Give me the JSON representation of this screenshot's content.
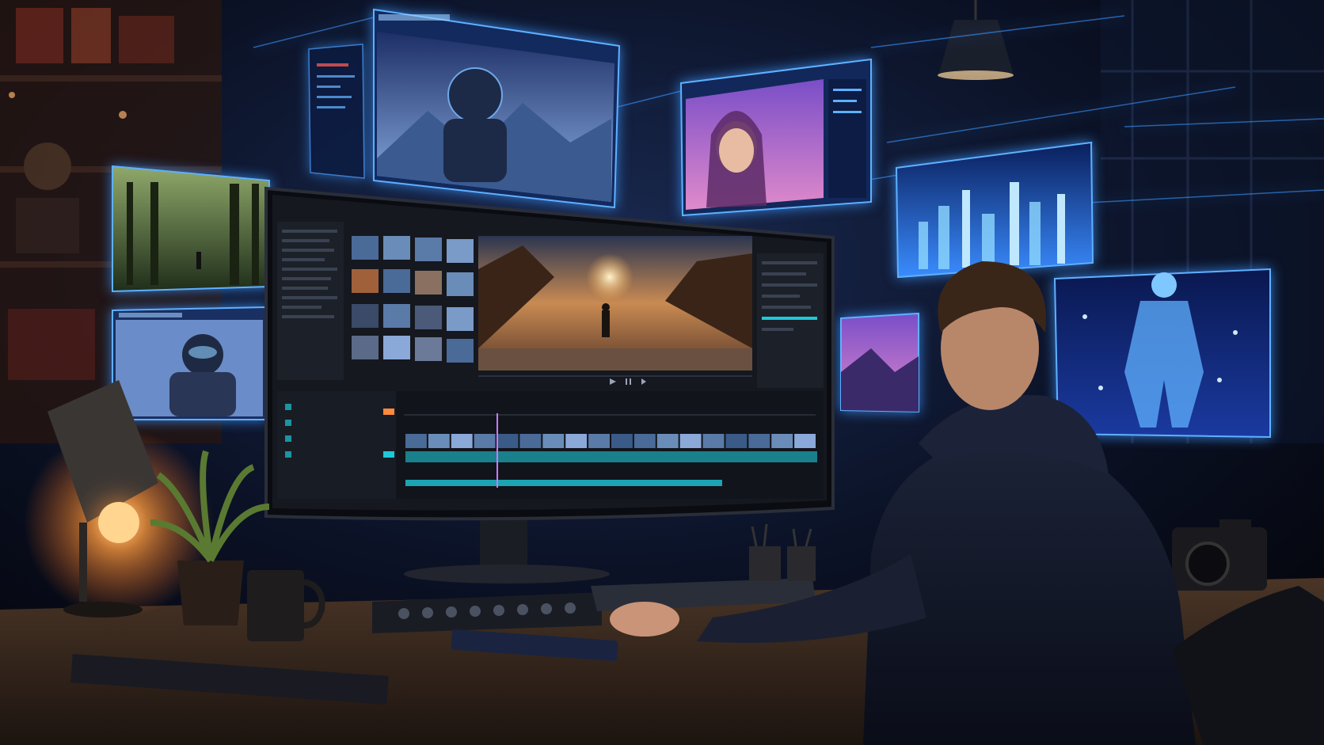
{
  "scene": {
    "holo_panels": [
      {
        "name": "holo-panel-astronaut-mountains",
        "subject": "astronaut-portrait",
        "header_text": ""
      },
      {
        "name": "holo-panel-woman-portrait",
        "subject": "portrait"
      },
      {
        "name": "holo-panel-forest-path",
        "subject": "forest"
      },
      {
        "name": "holo-panel-armored-soldier",
        "subject": "soldier"
      },
      {
        "name": "holo-panel-futuristic-city",
        "subject": "city-skyline"
      },
      {
        "name": "holo-panel-glowing-figure",
        "subject": "glowing-figure"
      },
      {
        "name": "holo-panel-purple-landscape",
        "subject": "landscape"
      }
    ],
    "monitor": {
      "app": "video-editing-suite",
      "preview_subject": "person-in-canyon-at-sunset",
      "timeline_clip_count": 18,
      "playback_icons": [
        "play-icon",
        "pause-icon",
        "skip-icon"
      ]
    },
    "colors": {
      "hologram_blue": "#3c96ff",
      "lamp_orange": "#ff9a3c",
      "ui_teal": "#1fc8d8",
      "room_dark": "#070b16"
    }
  }
}
